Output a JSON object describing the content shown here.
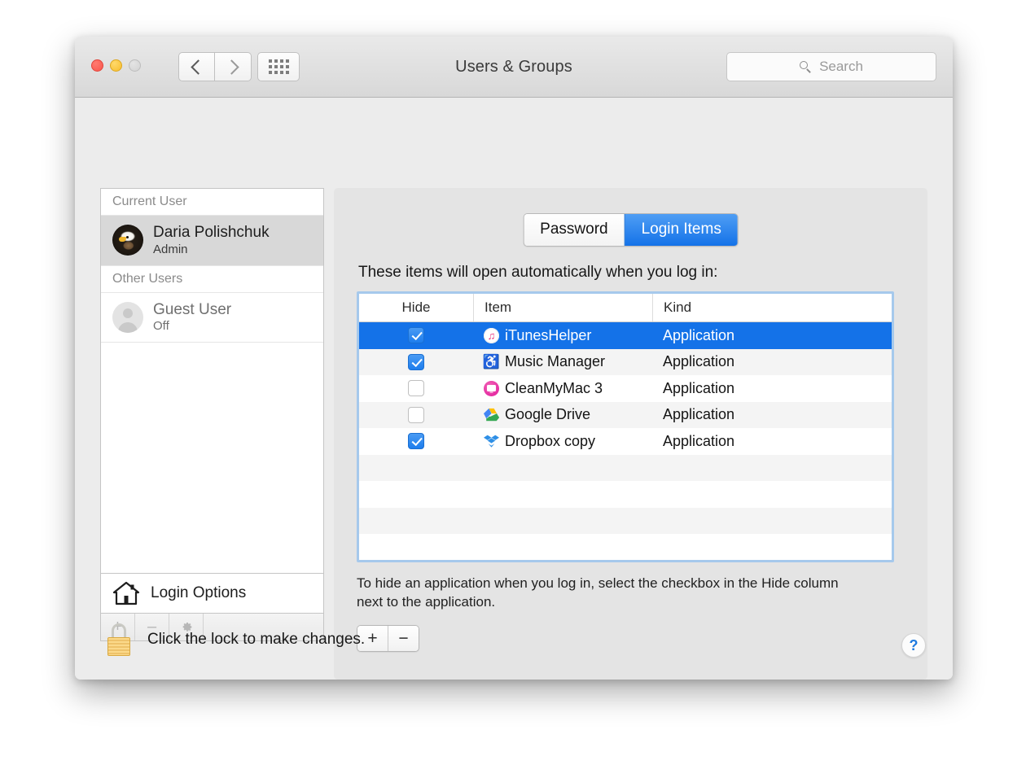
{
  "window": {
    "title": "Users & Groups",
    "traffic_lights": [
      "close",
      "minimize",
      "zoom"
    ],
    "nav": {
      "back_label": "‹",
      "forward_label": "›",
      "grid_label": "Show All"
    },
    "search": {
      "placeholder": "Search",
      "value": ""
    }
  },
  "sidebar": {
    "sections": [
      {
        "header": "Current User",
        "users": [
          {
            "name": "Daria Polishchuk",
            "role": "Admin",
            "avatar": "eagle-photo-avatar",
            "selected": true
          }
        ]
      },
      {
        "header": "Other Users",
        "users": [
          {
            "name": "Guest User",
            "role": "Off",
            "avatar": "generic-person-avatar",
            "selected": false
          }
        ]
      }
    ],
    "login_options_label": "Login Options",
    "login_options_icon": "house-icon",
    "toolbar": {
      "add_label": "+",
      "remove_label": "–",
      "settings_icon": "gear-icon"
    }
  },
  "content": {
    "tabs": [
      {
        "label": "Password",
        "active": false
      },
      {
        "label": "Login Items",
        "active": true
      }
    ],
    "heading": "These items will open automatically when you log in:",
    "table": {
      "columns": [
        "Hide",
        "Item",
        "Kind"
      ],
      "rows": [
        {
          "hide": true,
          "item": "iTunesHelper",
          "kind": "Application",
          "icon": "itunes-icon",
          "selected": true
        },
        {
          "hide": true,
          "item": "Music Manager",
          "kind": "Application",
          "icon": "headphones-icon",
          "selected": false
        },
        {
          "hide": false,
          "item": "CleanMyMac 3",
          "kind": "Application",
          "icon": "cleanmymac-icon",
          "selected": false
        },
        {
          "hide": false,
          "item": "Google Drive",
          "kind": "Application",
          "icon": "google-drive-icon",
          "selected": false
        },
        {
          "hide": true,
          "item": "Dropbox copy",
          "kind": "Application",
          "icon": "dropbox-icon",
          "selected": false
        }
      ],
      "empty_rows": 4
    },
    "hint": "To hide an application when you log in, select the checkbox in the Hide column next to the application.",
    "add_label": "+",
    "remove_label": "−"
  },
  "footer": {
    "lock_icon": "closed-lock-icon",
    "lock_text": "Click the lock to make changes.",
    "help_label": "?"
  },
  "colors": {
    "accent_blue": "#1472e8",
    "selected_row": "#1472e8",
    "table_focus_ring": "#a6c9ec",
    "help_blue": "#1e7ae0"
  }
}
